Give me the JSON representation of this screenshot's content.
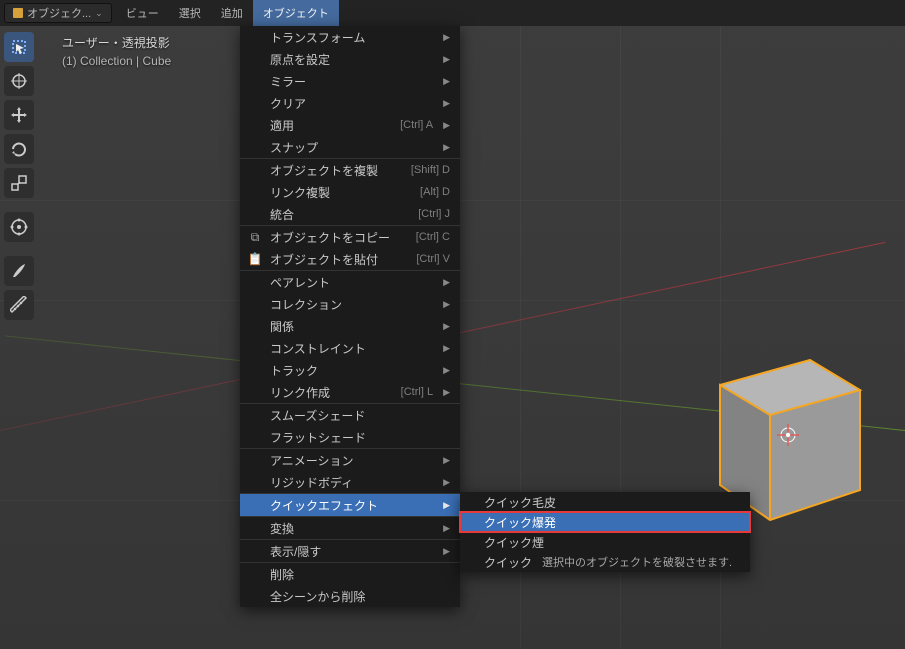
{
  "topbar": {
    "mode_label": "オブジェク...",
    "items": [
      "ビュー",
      "選択",
      "追加",
      "オブジェクト"
    ],
    "active_index": 3
  },
  "viewinfo": {
    "line1": "ユーザー・透視投影",
    "line2": "(1) Collection | Cube"
  },
  "tool_icons": [
    "select-box-icon",
    "cursor-icon",
    "move-icon",
    "rotate-icon",
    "scale-icon",
    "transform-icon",
    "annotate-icon",
    "measure-icon"
  ],
  "menu": [
    {
      "type": "item",
      "label": "トランスフォーム",
      "sub": true
    },
    {
      "type": "item",
      "label": "原点を設定",
      "sub": true
    },
    {
      "type": "item",
      "label": "ミラー",
      "sub": true
    },
    {
      "type": "item",
      "label": "クリア",
      "sub": true
    },
    {
      "type": "item",
      "label": "適用",
      "short": "[Ctrl] A",
      "sub": true
    },
    {
      "type": "item",
      "label": "スナップ",
      "sub": true
    },
    {
      "type": "sep"
    },
    {
      "type": "item",
      "label": "オブジェクトを複製",
      "short": "[Shift] D"
    },
    {
      "type": "item",
      "label": "リンク複製",
      "short": "[Alt] D"
    },
    {
      "type": "item",
      "label": "統合",
      "short": "[Ctrl] J"
    },
    {
      "type": "sep"
    },
    {
      "type": "item",
      "icon": "copy-icon",
      "label": "オブジェクトをコピー",
      "short": "[Ctrl] C"
    },
    {
      "type": "item",
      "icon": "paste-icon",
      "label": "オブジェクトを貼付",
      "short": "[Ctrl] V"
    },
    {
      "type": "sep"
    },
    {
      "type": "item",
      "label": "ペアレント",
      "sub": true
    },
    {
      "type": "item",
      "label": "コレクション",
      "sub": true
    },
    {
      "type": "item",
      "label": "関係",
      "sub": true
    },
    {
      "type": "item",
      "label": "コンストレイント",
      "sub": true
    },
    {
      "type": "item",
      "label": "トラック",
      "sub": true
    },
    {
      "type": "item",
      "label": "リンク作成",
      "short": "[Ctrl] L",
      "sub": true
    },
    {
      "type": "sep"
    },
    {
      "type": "item",
      "label": "スムーズシェード"
    },
    {
      "type": "item",
      "label": "フラットシェード"
    },
    {
      "type": "sep"
    },
    {
      "type": "item",
      "label": "アニメーション",
      "sub": true
    },
    {
      "type": "item",
      "label": "リジッドボディ",
      "sub": true
    },
    {
      "type": "sep"
    },
    {
      "type": "item",
      "label": "クイックエフェクト",
      "sub": true,
      "hl": true
    },
    {
      "type": "sep"
    },
    {
      "type": "item",
      "label": "変換",
      "sub": true
    },
    {
      "type": "sep"
    },
    {
      "type": "item",
      "label": "表示/隠す",
      "sub": true
    },
    {
      "type": "sep"
    },
    {
      "type": "item",
      "label": "削除"
    },
    {
      "type": "item",
      "label": "全シーンから削除"
    }
  ],
  "submenu": {
    "items": [
      {
        "label": "クイック毛皮"
      },
      {
        "label": "クイック爆発",
        "hl": true,
        "redbox": true
      },
      {
        "label": "クイック煙"
      },
      {
        "label": "クイック",
        "hint": "選択中のオブジェクトを破裂させます."
      }
    ]
  },
  "colors": {
    "accent": "#3a6fb6",
    "menu_bg": "#1b1b1b",
    "highlight_outline": "#e63a3a",
    "selection_outline": "#f5a623"
  }
}
